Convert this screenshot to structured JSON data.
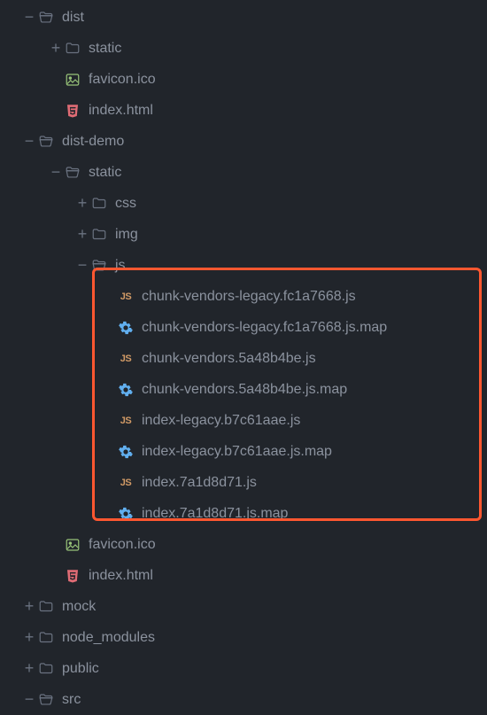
{
  "colors": {
    "folder": "#6a7280",
    "folderOpen": "#6a7280",
    "js": "#d19a66",
    "html": "#e06c75",
    "image": "#98c379",
    "gear": "#61afef",
    "highlight": "#ff5730"
  },
  "tree": [
    {
      "indent": 0,
      "toggle": "minus",
      "icon": "folder-open",
      "name": "dist"
    },
    {
      "indent": 1,
      "toggle": "plus",
      "icon": "folder",
      "name": "static"
    },
    {
      "indent": 1,
      "toggle": "",
      "icon": "image",
      "name": "favicon.ico"
    },
    {
      "indent": 1,
      "toggle": "",
      "icon": "html",
      "name": "index.html"
    },
    {
      "indent": 0,
      "toggle": "minus",
      "icon": "folder-open",
      "name": "dist-demo"
    },
    {
      "indent": 1,
      "toggle": "minus",
      "icon": "folder-open",
      "name": "static"
    },
    {
      "indent": 2,
      "toggle": "plus",
      "icon": "folder",
      "name": "css"
    },
    {
      "indent": 2,
      "toggle": "plus",
      "icon": "folder",
      "name": "img"
    },
    {
      "indent": 2,
      "toggle": "minus",
      "icon": "folder-open",
      "name": "js"
    },
    {
      "indent": 3,
      "toggle": "",
      "icon": "js",
      "name": "chunk-vendors-legacy.fc1a7668.js"
    },
    {
      "indent": 3,
      "toggle": "",
      "icon": "gear",
      "name": "chunk-vendors-legacy.fc1a7668.js.map"
    },
    {
      "indent": 3,
      "toggle": "",
      "icon": "js",
      "name": "chunk-vendors.5a48b4be.js"
    },
    {
      "indent": 3,
      "toggle": "",
      "icon": "gear",
      "name": "chunk-vendors.5a48b4be.js.map"
    },
    {
      "indent": 3,
      "toggle": "",
      "icon": "js",
      "name": "index-legacy.b7c61aae.js"
    },
    {
      "indent": 3,
      "toggle": "",
      "icon": "gear",
      "name": "index-legacy.b7c61aae.js.map"
    },
    {
      "indent": 3,
      "toggle": "",
      "icon": "js",
      "name": "index.7a1d8d71.js"
    },
    {
      "indent": 3,
      "toggle": "",
      "icon": "gear",
      "name": "index.7a1d8d71.js.map"
    },
    {
      "indent": 1,
      "toggle": "",
      "icon": "image",
      "name": "favicon.ico"
    },
    {
      "indent": 1,
      "toggle": "",
      "icon": "html",
      "name": "index.html"
    },
    {
      "indent": 0,
      "toggle": "plus",
      "icon": "folder",
      "name": "mock"
    },
    {
      "indent": 0,
      "toggle": "plus",
      "icon": "folder",
      "name": "node_modules"
    },
    {
      "indent": 0,
      "toggle": "plus",
      "icon": "folder",
      "name": "public"
    },
    {
      "indent": 0,
      "toggle": "minus",
      "icon": "folder-open",
      "name": "src"
    }
  ],
  "indentStep": 30,
  "baseIndent": 24
}
